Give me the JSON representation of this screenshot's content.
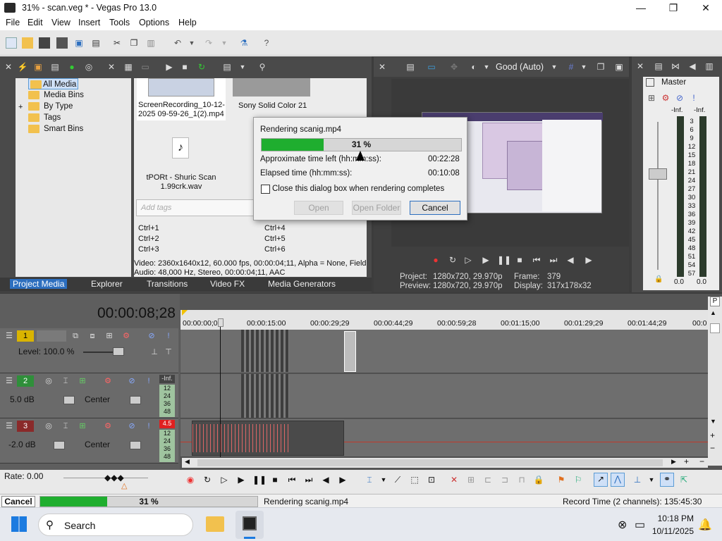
{
  "window": {
    "title": "31% - scan.veg * - Vegas Pro 13.0",
    "minimize": "—",
    "maximize": "❐",
    "close": "✕"
  },
  "menu": [
    "File",
    "Edit",
    "View",
    "Insert",
    "Tools",
    "Options",
    "Help"
  ],
  "explorer": {
    "tree": [
      "All Media",
      "Media Bins",
      "By Type",
      "Tags",
      "Smart Bins"
    ],
    "expander": "+",
    "media": [
      {
        "name": "ScreenRecording_10-12-2025 09-59-26_1(2).mp4"
      },
      {
        "name": "Sony Solid Color 21"
      },
      {
        "name": "tPORt - Shuric Scan 1.99crk.wav"
      }
    ],
    "tags_placeholder": "Add tags",
    "shortcuts": [
      "Ctrl+1",
      "Ctrl+2",
      "Ctrl+3",
      "Ctrl+4",
      "Ctrl+5",
      "Ctrl+6"
    ],
    "info_video": "Video: 2360x1640x12, 60.000 fps, 00:00:04;11, Alpha = None, Field",
    "info_audio": "Audio: 48,000 Hz, Stereo, 00:00:04;11, AAC",
    "tabs": [
      "Project Media",
      "Explorer",
      "Transitions",
      "Video FX",
      "Media Generators"
    ]
  },
  "preview": {
    "quality": "Good (Auto)",
    "project_label": "Project:",
    "project_value": "1280x720, 29.970p",
    "preview_label": "Preview:",
    "preview_value": "1280x720, 29.970p",
    "frame_label": "Frame:",
    "frame_value": "379",
    "display_label": "Display:",
    "display_value": "317x178x32"
  },
  "master": {
    "title": "Master",
    "inf_left": "-Inf.",
    "inf_right": "-Inf.",
    "scale": [
      "3",
      "6",
      "9",
      "12",
      "15",
      "18",
      "21",
      "24",
      "27",
      "30",
      "33",
      "36",
      "39",
      "42",
      "45",
      "48",
      "51",
      "54",
      "57"
    ],
    "bottom_left": "0.0",
    "bottom_right": "0.0"
  },
  "dialog": {
    "title": "Rendering scanig.mp4",
    "progress_percent": 31,
    "progress_text": "31 %",
    "time_left_label": "Approximate time left (hh:mm:ss):",
    "time_left_value": "00:22:28",
    "elapsed_label": "Elapsed time (hh:mm:ss):",
    "elapsed_value": "00:10:08",
    "close_checkbox_label": "Close this dialog box when rendering completes",
    "open": "Open",
    "open_folder": "Open Folder",
    "cancel": "Cancel"
  },
  "timeline": {
    "timecode": "00:00:08;28",
    "ruler": [
      "00:00:00;00",
      "00:00:15:00",
      "00:00:29;29",
      "00:00:44;29",
      "00:00:59;28",
      "00:01:15;00",
      "00:01:29;29",
      "00:01:44;29",
      "00:0"
    ],
    "tracks": [
      {
        "num": "1",
        "level": "Level: 100.0 %"
      },
      {
        "num": "2",
        "level": "5.0 dB",
        "pan": "Center",
        "peak": "-Inf.",
        "scale": [
          "12",
          "24",
          "36",
          "48"
        ]
      },
      {
        "num": "3",
        "level": "-2.0 dB",
        "pan": "Center",
        "peak": "4.5",
        "scale": [
          "12",
          "24",
          "36",
          "48"
        ]
      }
    ],
    "rate": "Rate: 0.00",
    "scroll_p": "P"
  },
  "status": {
    "cancel": "Cancel",
    "progress_percent": 31,
    "progress_text": "31 %",
    "message": "Rendering scanig.mp4",
    "record_time": "Record Time (2 channels): 135:45:30"
  },
  "taskbar": {
    "search": "Search",
    "time": "10:18 PM",
    "date": "10/11/2025"
  },
  "colors": {
    "accent": "#2d6fbf",
    "progress": "#1fae2f",
    "track_red": "#c0392b"
  }
}
